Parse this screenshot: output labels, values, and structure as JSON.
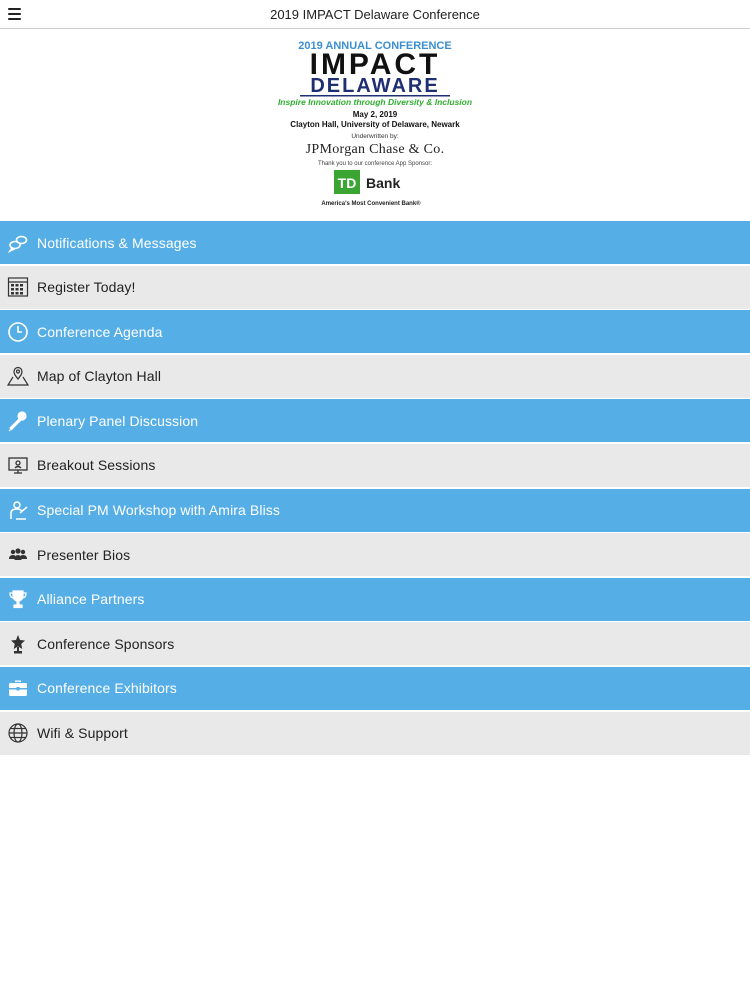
{
  "header": {
    "title": "2019 IMPACT Delaware Conference"
  },
  "banner": {
    "annual": "2019 ANNUAL CONFERENCE",
    "impact": "IMPACT",
    "delaware": "DELAWARE",
    "tagline": "Inspire Innovation through Diversity & Inclusion",
    "date": "May 2, 2019",
    "location": "Clayton Hall, University of Delaware, Newark",
    "underwritten": "Underwritten by:",
    "jpm": "JPMorgan Chase & Co.",
    "thanks": "Thank you to our conference App Sponsor:",
    "td": "TD",
    "bank": "Bank",
    "bank_slogan": "America's Most Convenient Bank®"
  },
  "colors": {
    "blue_row": "#56aee6",
    "gray_row": "#e9e9e9",
    "td_green": "#3aa532",
    "tagline_green": "#2fae2f",
    "navy": "#1f2f73",
    "annual_blue": "#3b8fd0"
  },
  "menu": [
    {
      "label": "Notifications & Messages",
      "icon": "chat-bubbles-icon"
    },
    {
      "label": "Register Today!",
      "icon": "calendar-icon"
    },
    {
      "label": "Conference Agenda",
      "icon": "clock-icon"
    },
    {
      "label": "Map of Clayton Hall",
      "icon": "map-pin-icon"
    },
    {
      "label": "Plenary Panel Discussion",
      "icon": "microphone-icon"
    },
    {
      "label": "Breakout Sessions",
      "icon": "presentation-icon"
    },
    {
      "label": "Special PM Workshop with Amira Bliss",
      "icon": "speaker-icon"
    },
    {
      "label": "Presenter Bios",
      "icon": "people-icon"
    },
    {
      "label": "Alliance Partners",
      "icon": "trophy-icon"
    },
    {
      "label": "Conference Sponsors",
      "icon": "award-icon"
    },
    {
      "label": "Conference Exhibitors",
      "icon": "briefcase-icon"
    },
    {
      "label": "Wifi & Support",
      "icon": "globe-icon"
    }
  ]
}
